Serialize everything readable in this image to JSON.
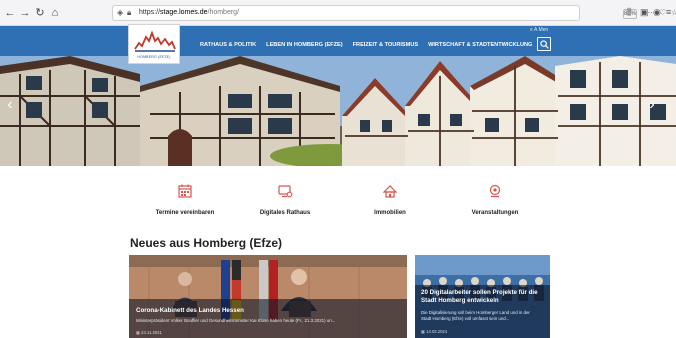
{
  "browser": {
    "url_scheme": "https://",
    "url_host": "stage.lomes.de",
    "url_path": "/homberg/",
    "zoom": "80%"
  },
  "site": {
    "logo_text": "HOMBERG (EFZE)",
    "top_right": "≡ A Men",
    "nav": [
      "RATHAUS & POLITIK",
      "LEBEN IN HOMBERG (EFZE)",
      "FREIZEIT & TOURISMUS",
      "WIRTSCHAFT & STADTENTWICKLUNG"
    ],
    "brand_color": "#2f6fb3"
  },
  "quick_links": [
    {
      "label": "Termine vereinbaren",
      "icon": "calendar-icon"
    },
    {
      "label": "Digitales Rathaus",
      "icon": "digital-town-hall-icon"
    },
    {
      "label": "Immobilien",
      "icon": "real-estate-icon"
    },
    {
      "label": "Veranstaltungen",
      "icon": "events-icon"
    }
  ],
  "news": {
    "heading": "Neues aus Homberg (Efze)",
    "cards": [
      {
        "title": "Corona-Kabinett des Landes Hessen",
        "text": "Ministerpräsident Volker Bouffier und Gesundheitsminister Kai Klose haben heute (Fr., 21.3.2021) un...",
        "date": "24.11.2021"
      },
      {
        "title": "20 Digitalarbeiter sollen Projekte für die Stadt Homberg entwickeln",
        "text_line1": "Die Digitalisierung soll beim Homberger Land und in der",
        "text_line2": "Stadt Homberg (Efze) voll umfasst sein und...",
        "date": "14.03.2024"
      }
    ]
  }
}
